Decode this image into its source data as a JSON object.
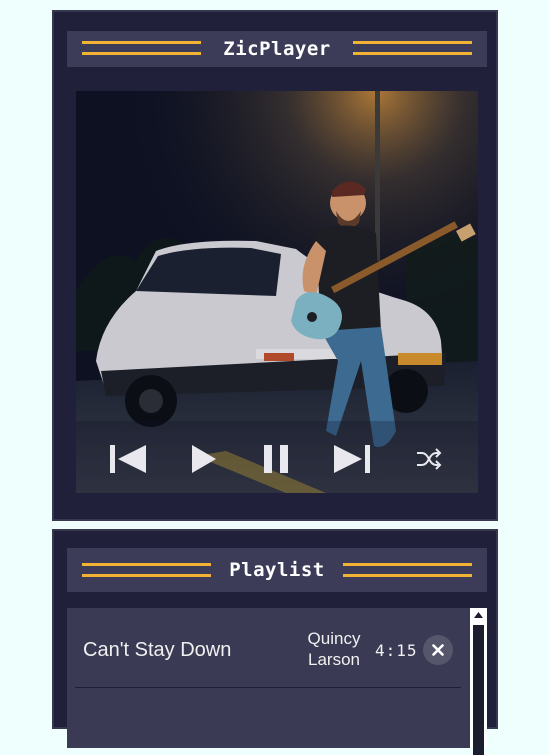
{
  "player": {
    "title": "ZicPlayer",
    "controls": {
      "previous_icon": "skip-previous-icon",
      "play_icon": "play-icon",
      "pause_icon": "pause-icon",
      "next_icon": "skip-next-icon",
      "shuffle_icon": "shuffle-icon"
    }
  },
  "playlist": {
    "title": "Playlist",
    "tracks": [
      {
        "title": "Can't Stay Down",
        "artist": "Quincy Larson",
        "duration": "4:15",
        "remove_icon": "close-icon"
      }
    ]
  },
  "colors": {
    "background": "#eefffd",
    "panel": "#20203a",
    "accent": "#f2b233",
    "title_bar": "#3c3c58"
  }
}
